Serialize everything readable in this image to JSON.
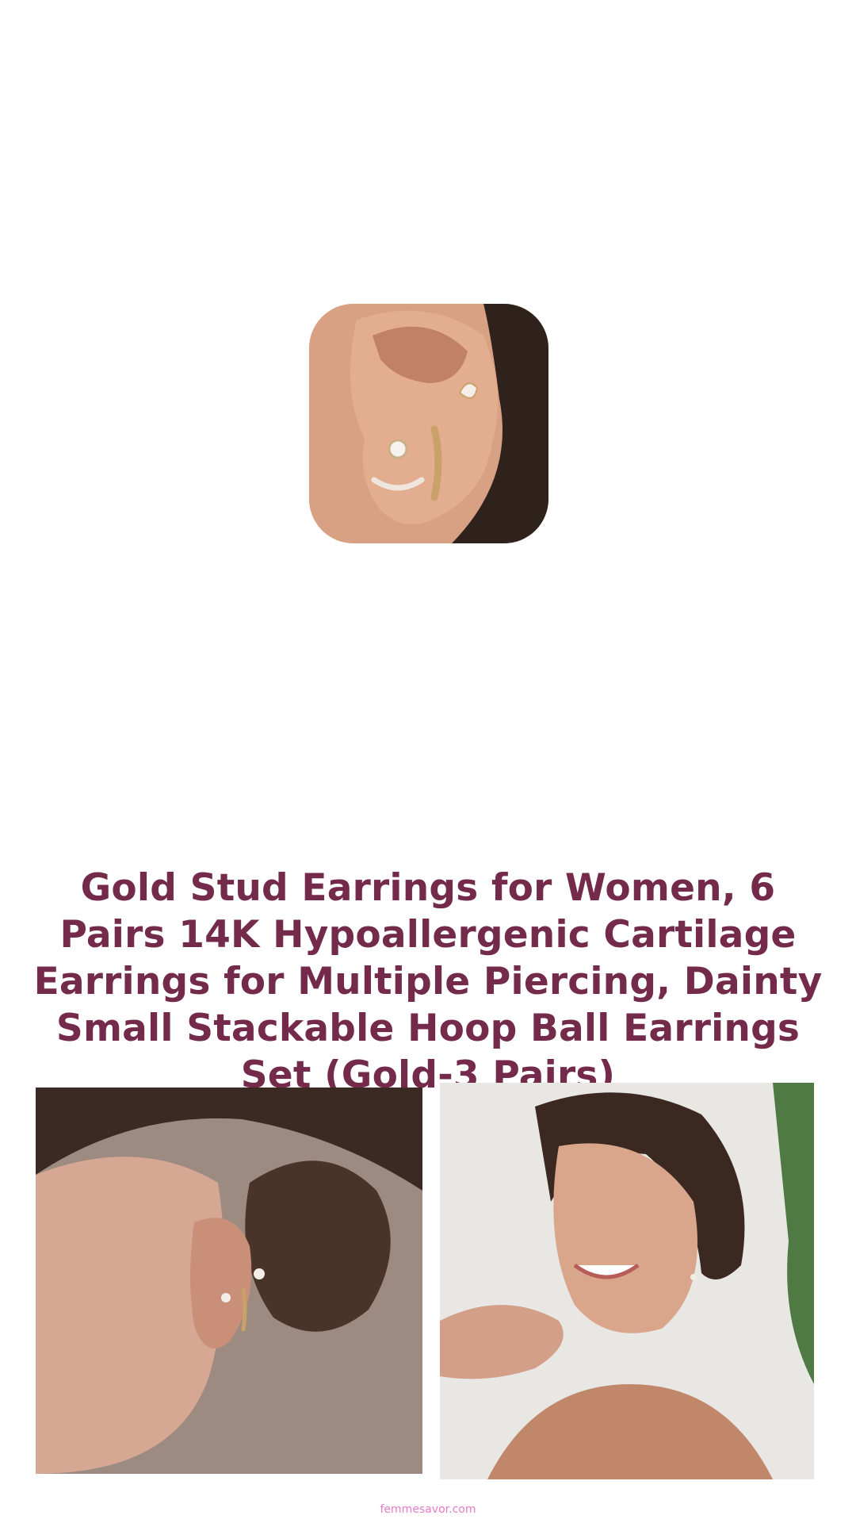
{
  "product": {
    "title": "Gold Stud Earrings for Women, 6 Pairs 14K Hypoallergenic Cartilage Earrings for Multiple Piercing, Dainty Small Stackable Hoop Ball Earrings Set (Gold-3 Pairs)",
    "thumbnail_icon": "ear-earrings-closeup-image"
  },
  "gallery": {
    "left_image_icon": "ear-piercing-side-profile-image",
    "right_image_icon": "smiling-woman-wearing-earrings-image"
  },
  "footer": {
    "site_link": "femmesavor.com"
  },
  "colors": {
    "title": "#742a4a",
    "footer_link": "#e77bc9",
    "background": "#ffffff"
  }
}
